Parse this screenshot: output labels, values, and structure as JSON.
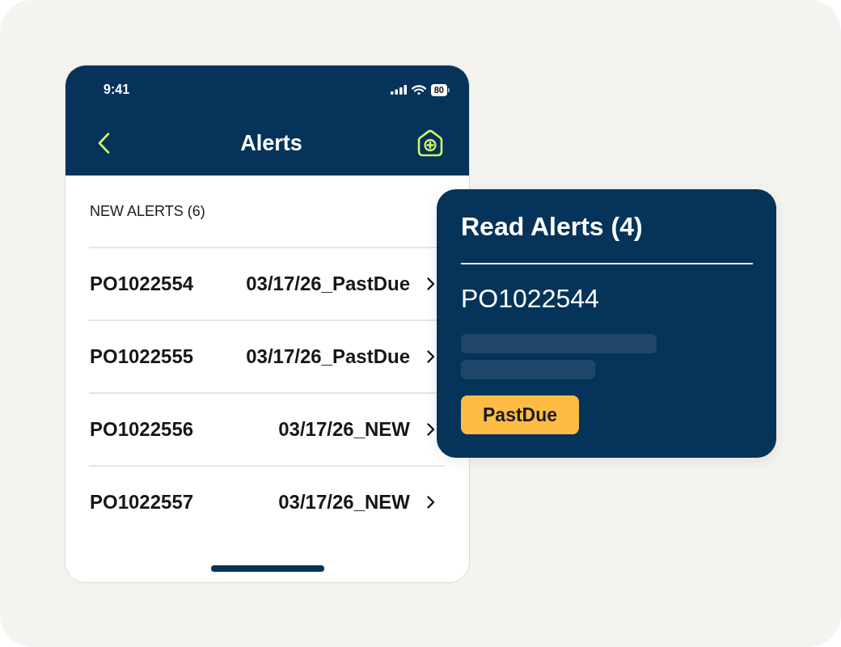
{
  "status_bar": {
    "time": "9:41",
    "battery": "80"
  },
  "header": {
    "title": "Alerts"
  },
  "new_alerts": {
    "heading": "NEW ALERTS (6)",
    "items": [
      {
        "id": "PO1022554",
        "label": "03/17/26_PastDue"
      },
      {
        "id": "PO1022555",
        "label": "03/17/26_PastDue"
      },
      {
        "id": "PO1022556",
        "label": "03/17/26_NEW"
      },
      {
        "id": "PO1022557",
        "label": "03/17/26_NEW"
      }
    ]
  },
  "read_alerts_card": {
    "title": "Read Alerts (4)",
    "id": "PO1022544",
    "badge": "PastDue"
  }
}
